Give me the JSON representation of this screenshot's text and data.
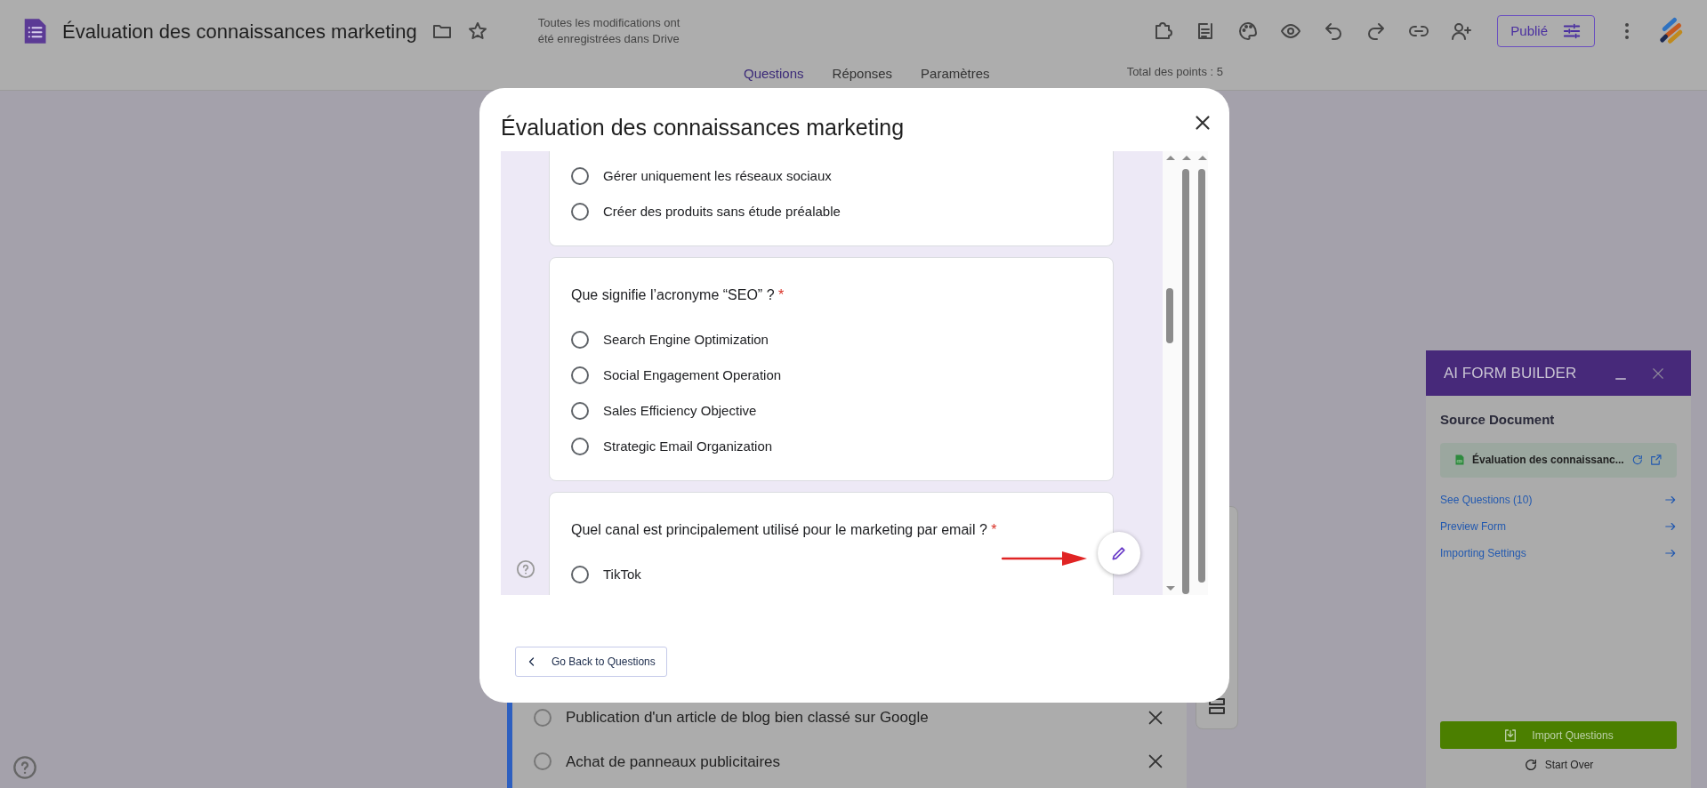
{
  "app_bar": {
    "title": "Évaluation des connaissances marketing",
    "save_status": "Toutes les modifications ont été enregistrées dans Drive",
    "publish_button": "Publié",
    "tabs": [
      {
        "label": "Questions",
        "selected": true
      },
      {
        "label": "Réponses",
        "selected": false
      },
      {
        "label": "Paramètres",
        "selected": false
      }
    ],
    "total_points": "Total des points : 5"
  },
  "background_form": {
    "options": [
      {
        "label": "Publication d'un article de blog bien classé sur Google",
        "selected": false
      },
      {
        "label": "Achat de panneaux publicitaires",
        "selected": false
      }
    ]
  },
  "dialog": {
    "title": "Évaluation des connaissances marketing",
    "questions": [
      {
        "options": [
          {
            "label": "Gérer uniquement les réseaux sociaux",
            "selected": false
          },
          {
            "label": "Créer des produits sans étude préalable",
            "selected": false
          }
        ]
      },
      {
        "question": "Que signifie l’acronyme “SEO” ?",
        "required_mark": "*",
        "options": [
          {
            "label": "Search Engine Optimization",
            "selected": false
          },
          {
            "label": "Social Engagement Operation",
            "selected": false
          },
          {
            "label": "Sales Efficiency Objective",
            "selected": false
          },
          {
            "label": "Strategic Email Organization",
            "selected": false
          }
        ]
      },
      {
        "question": "Quel canal est principalement utilisé pour le marketing par email ?",
        "required_mark": "*",
        "options": [
          {
            "label": "TikTok",
            "selected": false
          }
        ]
      }
    ],
    "back_button": "Go Back to Questions"
  },
  "side_panel": {
    "title": "AI FORM BUILDER",
    "section_title": "Source Document",
    "document_name": "Évaluation des connaissanc...",
    "links": [
      {
        "label": "See Questions (10)"
      },
      {
        "label": "Preview Form"
      },
      {
        "label": "Importing Settings"
      }
    ],
    "import_button": "Import Questions",
    "start_over": "Start Over"
  }
}
